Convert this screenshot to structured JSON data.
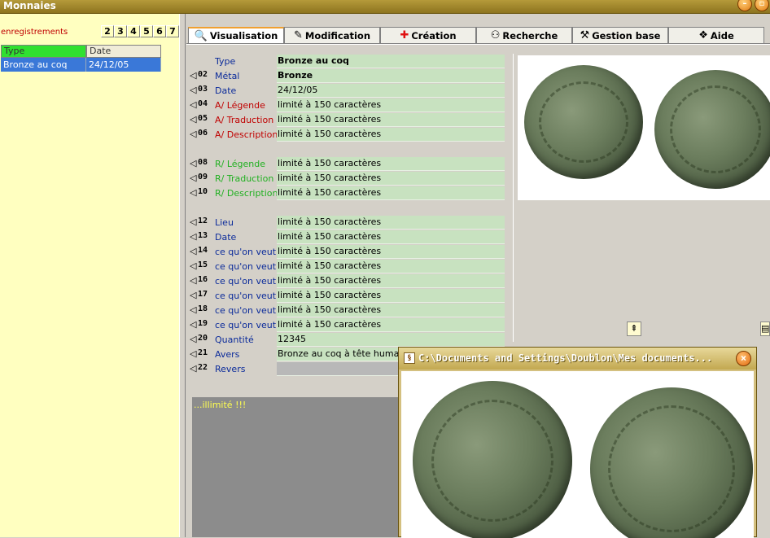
{
  "window": {
    "title": "Monnaies"
  },
  "left_panel": {
    "records_label": "enregistrements",
    "pages": [
      "2",
      "3",
      "4",
      "5",
      "6",
      "7"
    ],
    "columns": [
      "Type",
      "Date"
    ],
    "rows": [
      {
        "type": "Bronze au coq",
        "date": "24/12/05"
      }
    ]
  },
  "tabs": [
    {
      "label": "Visualisation",
      "icon": "magnifier-icon",
      "active": true
    },
    {
      "label": "Modification",
      "icon": "edit-icon"
    },
    {
      "label": "Création",
      "icon": "red-cross-icon"
    },
    {
      "label": "Recherche",
      "icon": "binoculars-icon"
    },
    {
      "label": "Gestion base",
      "icon": "tools-icon"
    },
    {
      "label": "Aide",
      "icon": "book-icon"
    }
  ],
  "fields": [
    {
      "num": "",
      "label": "Type",
      "value": "Bronze au coq",
      "color": "blue",
      "bold": true
    },
    {
      "num": "02",
      "label": "Métal",
      "value": "Bronze",
      "color": "blue",
      "bold": true
    },
    {
      "num": "03",
      "label": "Date",
      "value": "24/12/05",
      "color": "blue"
    },
    {
      "num": "04",
      "label": "A/ Légende",
      "value": "limité à 150 caractères",
      "color": "red"
    },
    {
      "num": "05",
      "label": "A/ Traduction",
      "value": "limité à 150 caractères",
      "color": "red"
    },
    {
      "num": "06",
      "label": "A/ Description",
      "value": "limité à 150 caractères",
      "color": "red"
    },
    {
      "num": "08",
      "label": "R/ Légende",
      "value": "limité à 150 caractères",
      "color": "green"
    },
    {
      "num": "09",
      "label": "R/ Traduction",
      "value": "limité à 150 caractères",
      "color": "green"
    },
    {
      "num": "10",
      "label": "R/ Description",
      "value": "limité à 150 caractères",
      "color": "green"
    },
    {
      "num": "12",
      "label": "Lieu",
      "value": "limité à 150 caractères",
      "color": "blue"
    },
    {
      "num": "13",
      "label": "Date",
      "value": "limité à 150 caractères",
      "color": "blue"
    },
    {
      "num": "14",
      "label": "ce qu'on veut",
      "value": "limité à 150 caractères",
      "color": "blue"
    },
    {
      "num": "15",
      "label": "ce qu'on veut",
      "value": "limité à 150 caractères",
      "color": "blue"
    },
    {
      "num": "16",
      "label": "ce qu'on veut",
      "value": "limité à 150 caractères",
      "color": "blue"
    },
    {
      "num": "17",
      "label": "ce qu'on veut",
      "value": "limité à 150 caractères",
      "color": "blue"
    },
    {
      "num": "18",
      "label": "ce qu'on veut",
      "value": "limité à 150 caractères",
      "color": "blue"
    },
    {
      "num": "19",
      "label": "ce qu'on veut",
      "value": "limité à 150 caractères",
      "color": "blue"
    },
    {
      "num": "20",
      "label": "Quantité",
      "value": "12345",
      "color": "blue"
    },
    {
      "num": "21",
      "label": "Avers",
      "value": "Bronze au coq à tête humaine",
      "color": "blue"
    },
    {
      "num": "22",
      "label": "Revers",
      "value": "",
      "color": "blue",
      "grey": true
    }
  ],
  "memo": {
    "text": "...illimité !!!"
  },
  "popup": {
    "title": "C:\\Documents and Settings\\Doublon\\Mes documents..."
  }
}
